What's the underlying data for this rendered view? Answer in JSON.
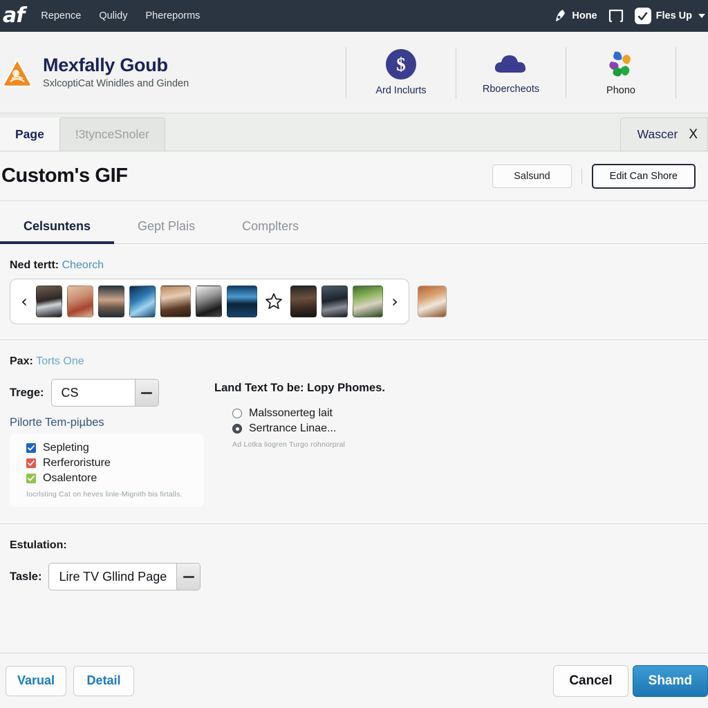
{
  "topbar": {
    "logo": "af",
    "nav": [
      {
        "label": "Repence"
      },
      {
        "label": "Qulidy"
      },
      {
        "label": "Phereporms"
      }
    ],
    "right": {
      "home_label": "Hone",
      "home_icon": "ribbon-icon",
      "frame_icon": "frame-icon",
      "check_icon": "check-icon",
      "files_label": "Fles Up",
      "caret_icon": "chevron-down-icon"
    },
    "bg_color": "#2b3441"
  },
  "brand": {
    "badge_icon": "warning-triangle-icon",
    "title": "Mexfally Goub",
    "subtitle": "SxlcoptiCat Winidles and Ginden",
    "title_color": "#1b2259",
    "apps": [
      {
        "label": "Ard Inclurts",
        "icon": "dollar-circle-icon"
      },
      {
        "label": "Rboercheots",
        "icon": "cloud-icon"
      },
      {
        "label": "Phono",
        "icon": "pinwheel-icon"
      }
    ]
  },
  "window_tabs": {
    "tabs": [
      {
        "label": "Page",
        "active": true
      },
      {
        "label": "!3tynceSnoler",
        "active": false
      }
    ],
    "right_tab": {
      "label": "Wascer",
      "close": "X"
    }
  },
  "title_row": {
    "title": "Custom's GIF",
    "secondary_button": "Salsund",
    "primary_button": "Edit Can Shore"
  },
  "content_tabs": [
    {
      "label": "Celsuntens",
      "active": true
    },
    {
      "label": "Gept Plais",
      "active": false
    },
    {
      "label": "Complters",
      "active": false
    }
  ],
  "carousel_section": {
    "label": "Ned tertt:",
    "link": "Cheorch",
    "prev_icon": "chevron-left-icon",
    "next_icon": "chevron-right-icon",
    "star_icon": "star-outline-icon",
    "thumbnails": [
      {
        "name": "thumb-portrait-suit"
      },
      {
        "name": "thumb-portrait-smile"
      },
      {
        "name": "thumb-portrait-man"
      },
      {
        "name": "thumb-blue-scene"
      },
      {
        "name": "thumb-portrait-hair"
      },
      {
        "name": "thumb-bw-photo"
      },
      {
        "name": "thumb-landscape-lake"
      },
      {
        "name": "thumb-portrait-dark"
      },
      {
        "name": "thumb-portrait-shadow"
      },
      {
        "name": "thumb-garden-green"
      }
    ],
    "solo_thumb": {
      "name": "thumb-orange-hands"
    }
  },
  "pax_section": {
    "label": "Pax:",
    "link": "Torts One",
    "select_label": "Trege:",
    "select_value": "CS",
    "sub_link": "Pilorte Tem-piµbes",
    "right_heading": "Land Text To be: Lopy Phomes.",
    "checkboxes": [
      {
        "label": "Sepleting",
        "color": "#1b65c6",
        "state": "blue"
      },
      {
        "label": "Rerferoristure",
        "color": "#e05a4e",
        "state": "red"
      },
      {
        "label": "Osalentore",
        "color": "#8fc44a",
        "state": "green"
      }
    ],
    "checkbox_helper": "Iocrlsting Cat on heves linle-Mignith  bis firtalls.",
    "radios": [
      {
        "label": "Malssonerteg lait",
        "selected": false
      },
      {
        "label": "Sertrance Linae...",
        "selected": true
      }
    ],
    "radio_helper": "Ad Lotka liogren Turgo rohnorpral"
  },
  "estulation_section": {
    "heading": "Estulation:",
    "select_label": "Tasle:",
    "select_value": "Lire TV Gllind Page"
  },
  "footer": {
    "left_buttons": [
      {
        "label": "Varual"
      },
      {
        "label": "Detail"
      }
    ],
    "cancel_label": "Cancel",
    "submit_label": "Shamd",
    "submit_color": "#1d77b4"
  }
}
